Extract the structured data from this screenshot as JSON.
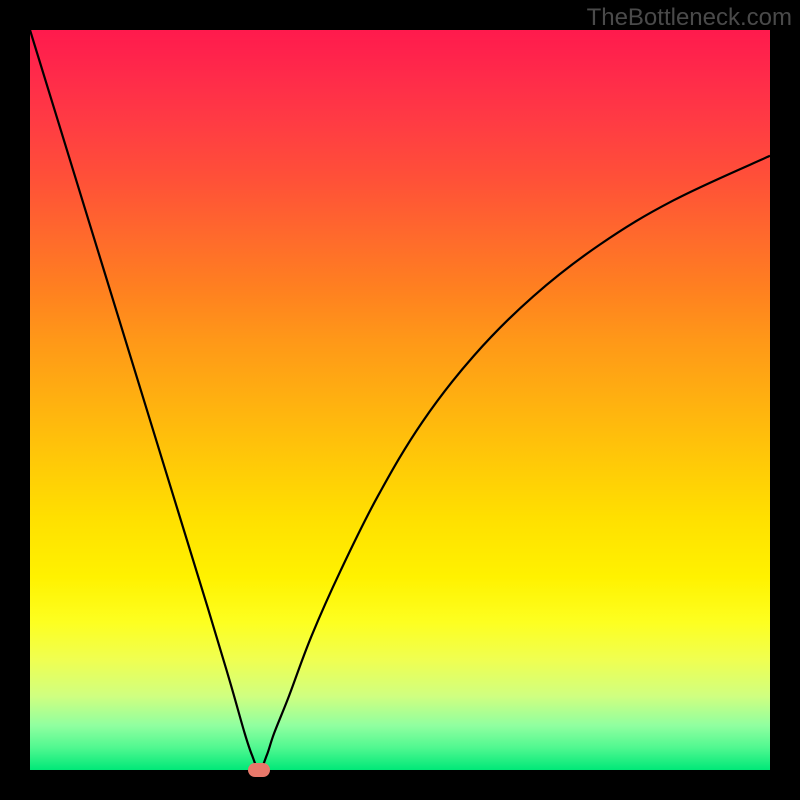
{
  "watermark": "TheBottleneck.com",
  "chart_data": {
    "type": "line",
    "title": "",
    "xlabel": "",
    "ylabel": "",
    "xlim": [
      0,
      100
    ],
    "ylim": [
      0,
      100
    ],
    "grid": false,
    "legend": false,
    "minimum_x": 31,
    "series": [
      {
        "name": "bottleneck-curve",
        "x": [
          0,
          4,
          8,
          12,
          16,
          20,
          24,
          27,
          29,
          30,
          31,
          32,
          33,
          35,
          38,
          42,
          47,
          53,
          60,
          68,
          77,
          87,
          100
        ],
        "y": [
          100,
          87,
          74,
          61,
          48,
          35,
          22,
          12,
          5,
          2,
          0,
          2,
          5,
          10,
          18,
          27,
          37,
          47,
          56,
          64,
          71,
          77,
          83
        ]
      }
    ],
    "marker": {
      "x": 31,
      "y": 0,
      "color": "#e8786a"
    },
    "background_gradient": {
      "top": "#ff1a4d",
      "middle": "#ffd000",
      "bottom": "#00e878"
    }
  }
}
